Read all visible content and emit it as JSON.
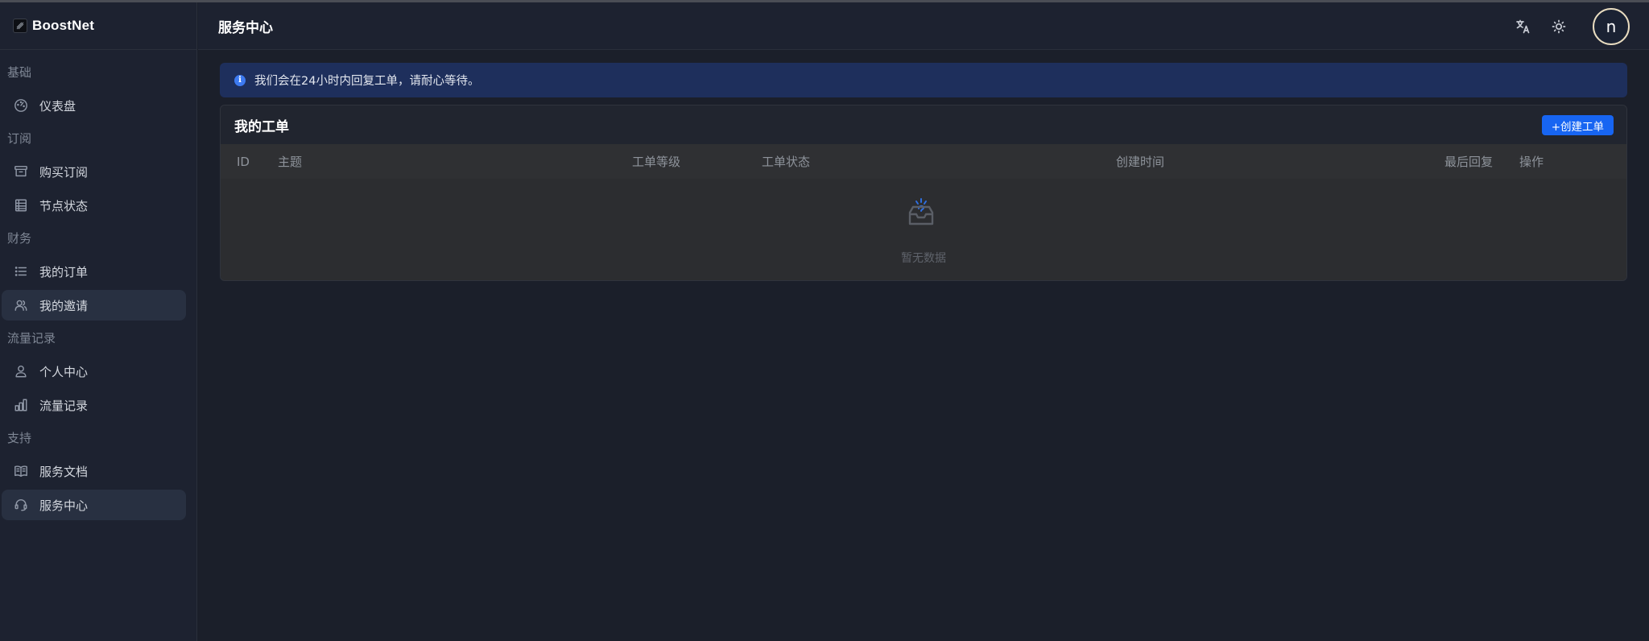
{
  "app": {
    "name": "BoostNet"
  },
  "header": {
    "title": "服务中心"
  },
  "user": {
    "avatar_letter": "n"
  },
  "sidebar": {
    "groups": [
      {
        "title": "基础",
        "items": [
          {
            "label": "仪表盘",
            "icon": "dashboard-icon"
          }
        ]
      },
      {
        "title": "订阅",
        "items": [
          {
            "label": "购买订阅",
            "icon": "archive-icon"
          },
          {
            "label": "节点状态",
            "icon": "table-icon"
          }
        ]
      },
      {
        "title": "财务",
        "items": [
          {
            "label": "我的订单",
            "icon": "list-icon"
          },
          {
            "label": "我的邀请",
            "icon": "users-icon"
          }
        ]
      },
      {
        "title": "流量记录",
        "items": [
          {
            "label": "个人中心",
            "icon": "user-icon"
          },
          {
            "label": "流量记录",
            "icon": "bar-chart-icon"
          }
        ]
      },
      {
        "title": "支持",
        "items": [
          {
            "label": "服务文档",
            "icon": "book-icon"
          },
          {
            "label": "服务中心",
            "icon": "headset-icon"
          }
        ]
      }
    ]
  },
  "alert": {
    "text": "我们会在24小时内回复工单，请耐心等待。"
  },
  "tickets": {
    "title": "我的工单",
    "create_label": "+创建工单",
    "columns": [
      "ID",
      "主题",
      "工单等级",
      "工单状态",
      "创建时间",
      "最后回复",
      "操作"
    ],
    "empty_text": "暂无数据"
  },
  "colors": {
    "accent": "#1765f2",
    "alert_bg": "#1e2f5c",
    "sidebar_bg": "#1d2230"
  }
}
